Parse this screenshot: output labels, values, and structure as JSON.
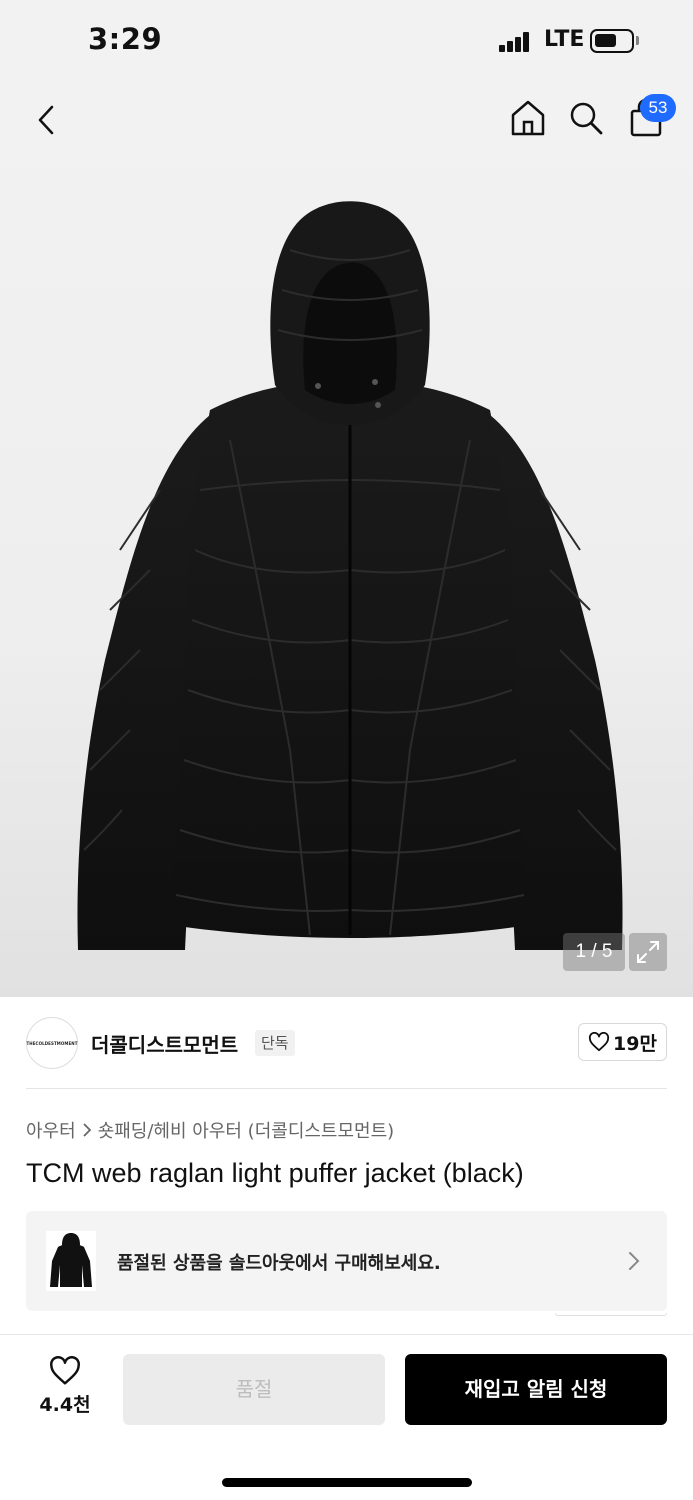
{
  "status_bar": {
    "time": "3:29",
    "network": "LTE"
  },
  "header": {
    "back_icon": "chevron-left-icon",
    "home_icon": "home-icon",
    "search_icon": "search-icon",
    "cart_icon": "shopping-bag-icon",
    "cart_count": "53",
    "badge_color": "#1f6bff"
  },
  "gallery": {
    "counter": "1 / 5",
    "expand_icon": "expand-icon"
  },
  "brand": {
    "logo_text": "THECOLDESTMOMENT",
    "name": "더콜디스트모먼트",
    "tag": "단독",
    "like_count": "19만"
  },
  "breadcrumb": {
    "category": "아우터",
    "subcategory": "숏패딩/헤비 아우터 (더콜디스트모먼트)"
  },
  "product": {
    "title": "TCM web raglan light puffer jacket (black)"
  },
  "soldout_banner": {
    "text": "품절된 상품을 솔드아웃에서 구매해보세요."
  },
  "bottom_bar": {
    "wish_count": "4.4천",
    "soldout_label": "품절",
    "restock_label": "재입고 알림 신청"
  }
}
